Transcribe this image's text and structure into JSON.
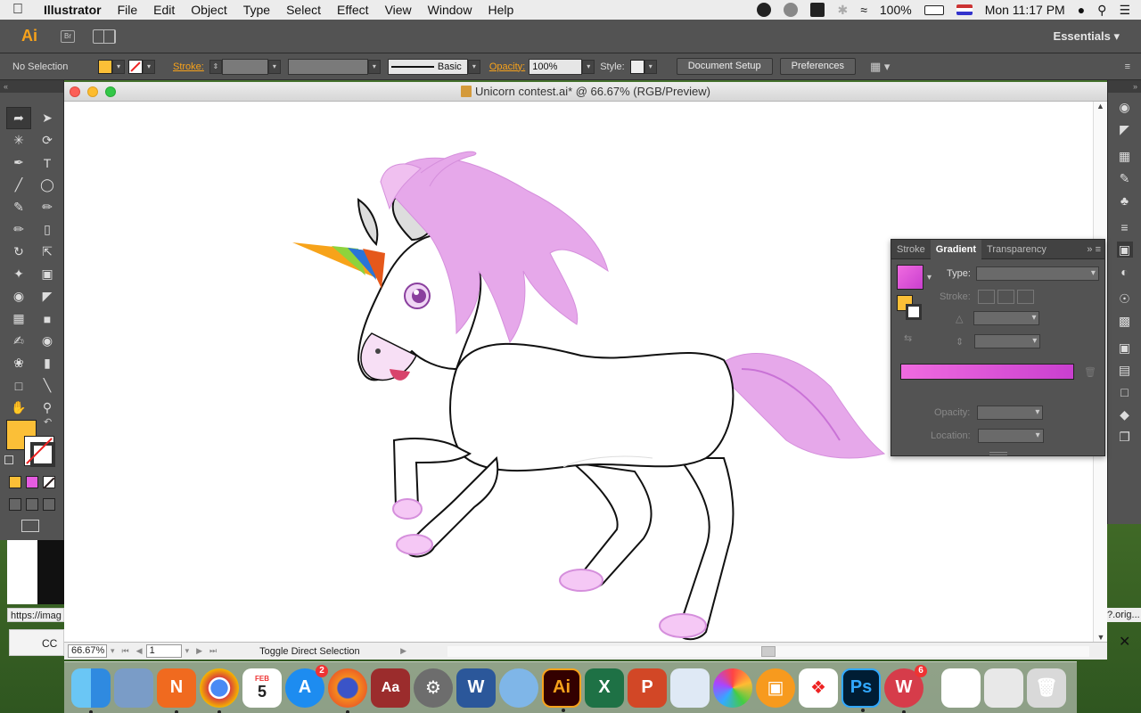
{
  "menubar": {
    "app_name": "Illustrator",
    "items": [
      "File",
      "Edit",
      "Object",
      "Type",
      "Select",
      "Effect",
      "View",
      "Window",
      "Help"
    ],
    "battery": "100%",
    "clock": "Mon 11:17 PM"
  },
  "appbar": {
    "logo": "Ai",
    "bridge": "Br",
    "workspace": "Essentials"
  },
  "control": {
    "selection": "No Selection",
    "stroke_label": "Stroke:",
    "brush": "Basic",
    "opacity_label": "Opacity:",
    "opacity_value": "100%",
    "style_label": "Style:",
    "doc_setup": "Document Setup",
    "preferences": "Preferences",
    "fill_color": "#fbbf37"
  },
  "document": {
    "title": "Unicorn contest.ai* @ 66.67% (RGB/Preview)",
    "zoom": "66.67%",
    "artboard": "1",
    "status": "Toggle Direct Selection"
  },
  "gradient_panel": {
    "tabs": [
      "Stroke",
      "Gradient",
      "Transparency"
    ],
    "type_label": "Type:",
    "stroke_label": "Stroke:",
    "opacity_label": "Opacity:",
    "location_label": "Location:",
    "gradient_start": "#f06be0",
    "gradient_end": "#c93fcf"
  },
  "browser": {
    "url_hint": "https://imag",
    "tab_hint": "CC",
    "right_hint": "?.orig..."
  },
  "dock": {
    "apps": [
      "finder",
      "preview",
      "notability",
      "chrome",
      "calendar",
      "app-store",
      "firefox",
      "dictionary",
      "system-preferences",
      "word",
      "migration",
      "illustrator",
      "excel",
      "wps-presentation",
      "preview-photos",
      "photos",
      "ibooks",
      "acrobat",
      "photoshop",
      "wps-writer",
      "document",
      "downloads",
      "trash"
    ],
    "calendar_month": "FEB",
    "calendar_day": "5",
    "app_store_badge": "2",
    "wps_badge": "6"
  }
}
